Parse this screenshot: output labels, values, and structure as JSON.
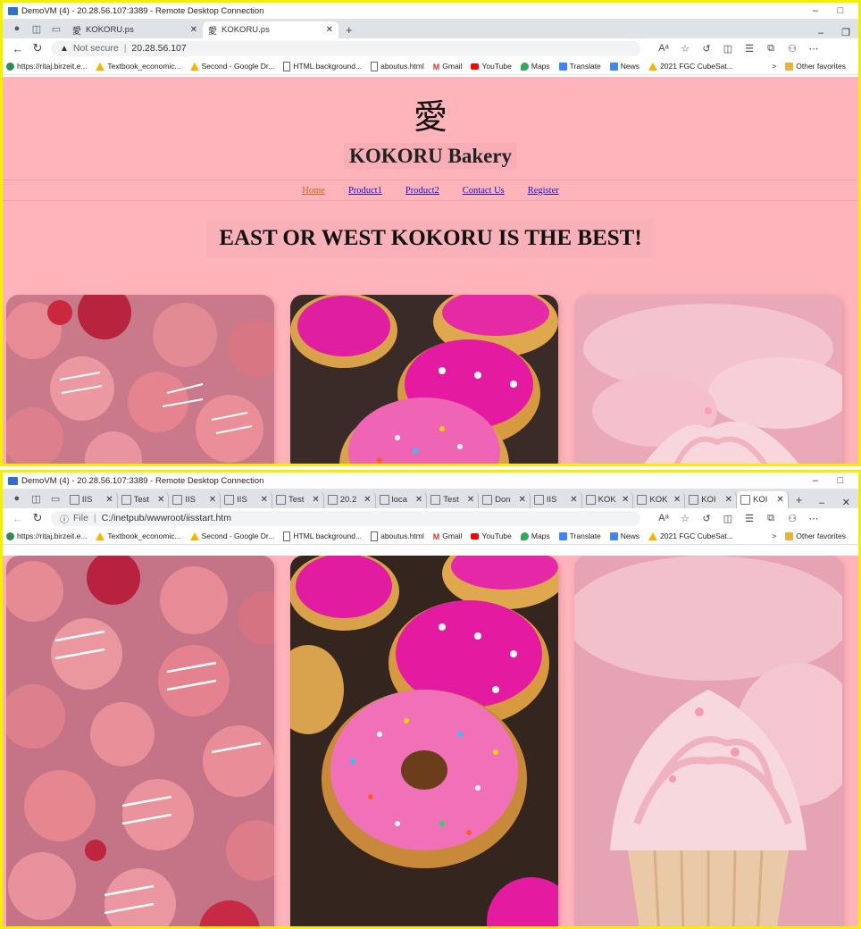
{
  "window": {
    "title": "DemoVM (4) - 20.28.56.107:3389 - Remote Desktop Connection",
    "minimize": "–",
    "maximize": "□"
  },
  "shot1": {
    "tabs": [
      {
        "label": "KOKORU.ps",
        "glyph": "愛",
        "close": "✕"
      },
      {
        "label": "KOKORU.ps",
        "glyph": "愛",
        "close": "✕"
      }
    ],
    "new_tab": "+",
    "address": {
      "security": "Not secure",
      "url": "20.28.56.107"
    }
  },
  "shot2": {
    "tabs": [
      {
        "label": "IIS"
      },
      {
        "label": "Test"
      },
      {
        "label": "IIS"
      },
      {
        "label": "IIS"
      },
      {
        "label": "Test"
      },
      {
        "label": "20.2"
      },
      {
        "label": "loca"
      },
      {
        "label": "Test"
      },
      {
        "label": "Don"
      },
      {
        "label": "IIS"
      },
      {
        "label": "KOK"
      },
      {
        "label": "KOK"
      },
      {
        "label": "KOI"
      },
      {
        "label": "KOI"
      }
    ],
    "new_tab": "+",
    "address": {
      "security": "File",
      "url": "C:/inetpub/wwwroot/iisstart.htm"
    }
  },
  "favorites": [
    {
      "label": "https://ritaj.birzeit.e...",
      "icon": "globe-icon",
      "color": "#2e8b57"
    },
    {
      "label": "Textbook_economic...",
      "icon": "drive-icon",
      "color": "#f4b400"
    },
    {
      "label": "Second - Google Dr...",
      "icon": "drive-icon",
      "color": "#f4b400"
    },
    {
      "label": "HTML background...",
      "icon": "page-icon",
      "color": "#666666"
    },
    {
      "label": "aboutus.html",
      "icon": "page-icon",
      "color": "#666666"
    },
    {
      "label": "Gmail",
      "icon": "gmail-icon",
      "color": "#d93025"
    },
    {
      "label": "YouTube",
      "icon": "youtube-icon",
      "color": "#ff0000"
    },
    {
      "label": "Maps",
      "icon": "maps-icon",
      "color": "#34a853"
    },
    {
      "label": "Translate",
      "icon": "translate-icon",
      "color": "#4285f4"
    },
    {
      "label": "News",
      "icon": "news-icon",
      "color": "#4285f4"
    },
    {
      "label": "2021 FGC CubeSat...",
      "icon": "drive-icon",
      "color": "#f4b400"
    }
  ],
  "favorites_more": ">",
  "other_favorites": "Other favorites",
  "site": {
    "logo": "愛",
    "title": "KOKORU Bakery",
    "nav": [
      "Home",
      "Product1",
      "Product2",
      "Contact Us",
      "Register"
    ],
    "slogan": "EAST OR WEST KOKORU IS THE BEST!",
    "images": [
      "macarons",
      "donuts",
      "cupcake"
    ]
  },
  "colors": {
    "page_bg": "#ffb3ba",
    "link": "#1a12c9",
    "active_link": "#d2641a",
    "frame_border": "#f5ee00"
  }
}
